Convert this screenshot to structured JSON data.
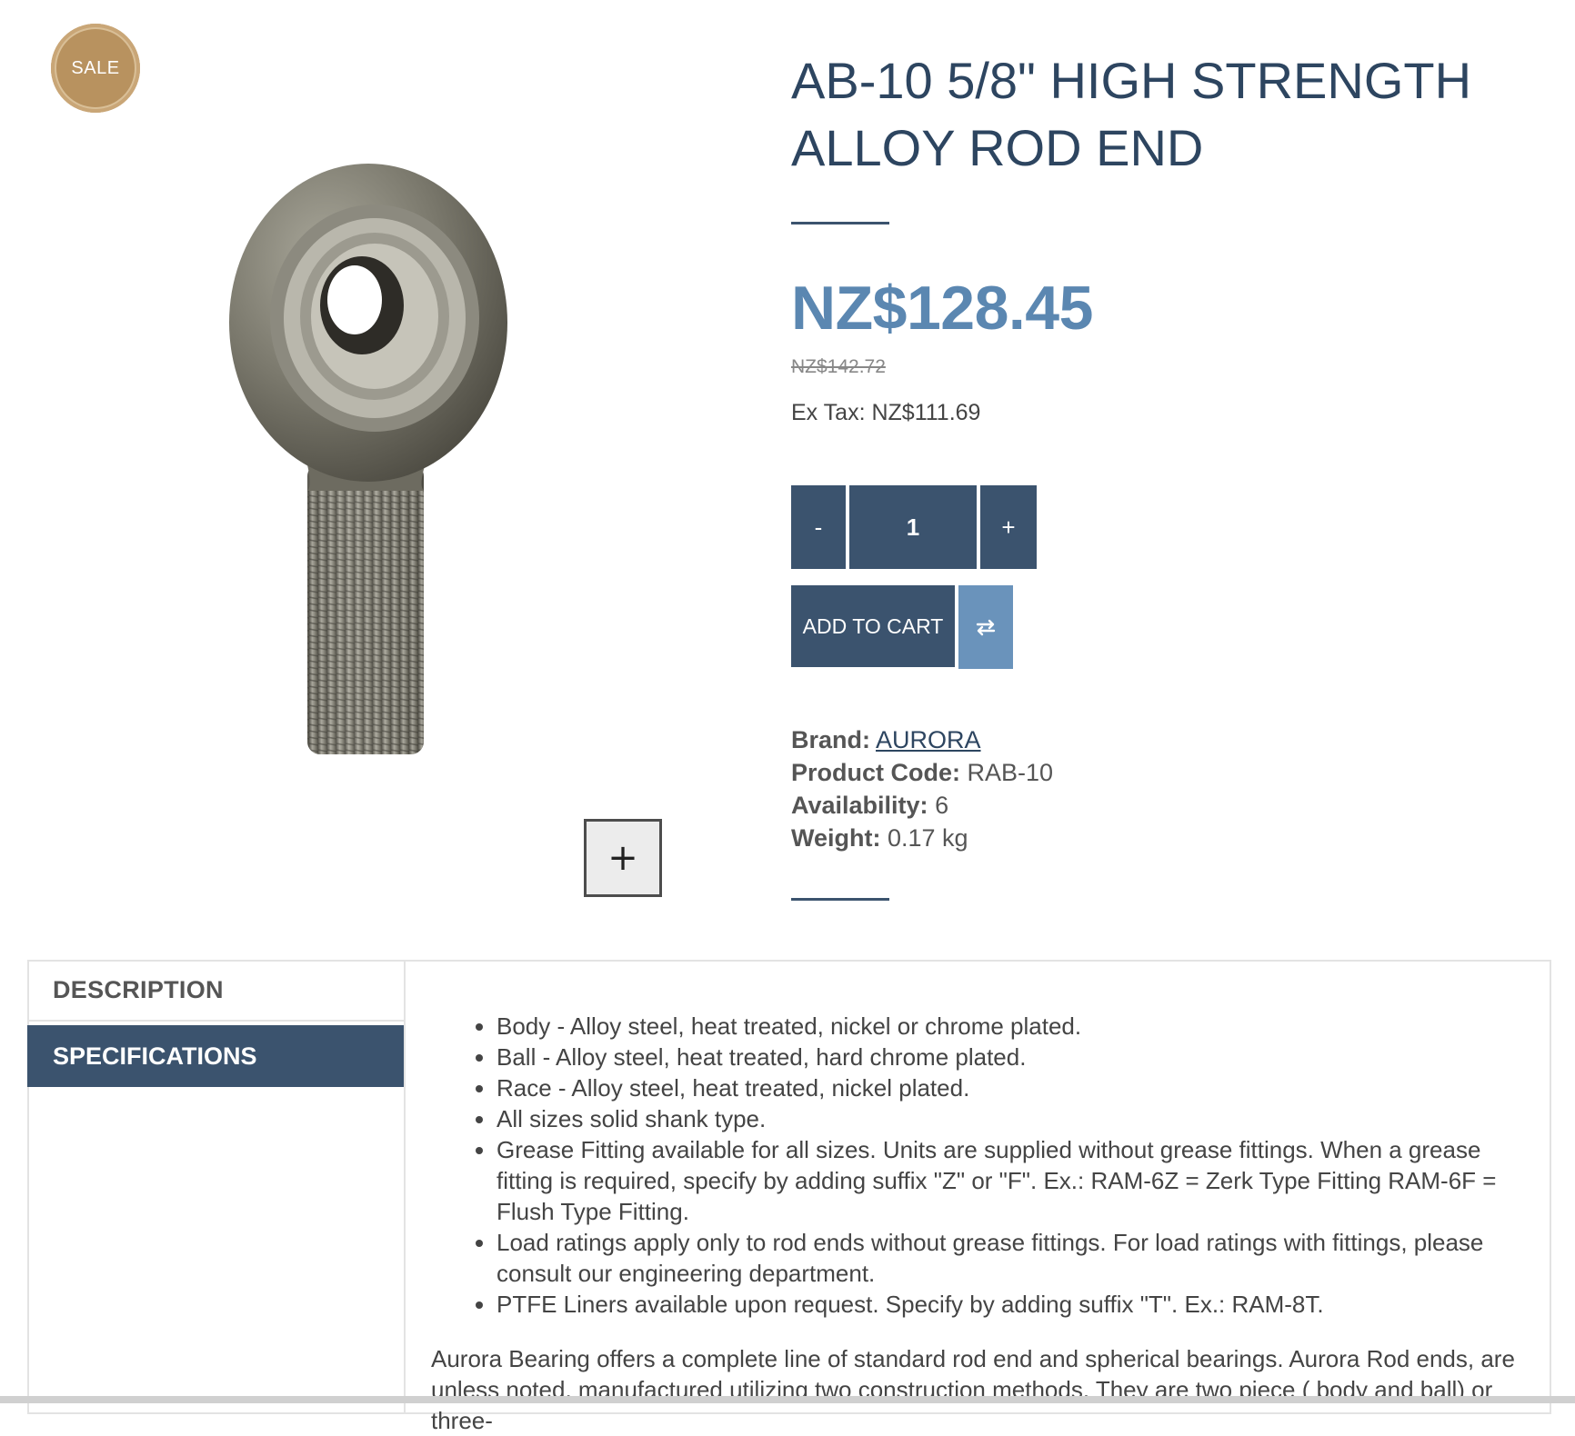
{
  "badge": {
    "label": "SALE",
    "color": "#b8925f"
  },
  "product": {
    "title": "AB-10 5/8\" HIGH STRENGTH ALLOY ROD END",
    "price": "NZ$128.45",
    "old_price": "NZ$142.72",
    "ex_tax": "Ex Tax: NZ$111.69"
  },
  "quantity": {
    "minus": "-",
    "value": "1",
    "plus": "+"
  },
  "cart": {
    "add_label": "ADD TO CART",
    "compare_icon": "compare-arrows-icon"
  },
  "meta": {
    "brand_label": "Brand:",
    "brand_value": "AURORA",
    "code_label": "Product Code:",
    "code_value": "RAB-10",
    "availability_label": "Availability:",
    "availability_value": "6",
    "weight_label": "Weight:",
    "weight_value": "0.17 kg"
  },
  "zoom": {
    "icon": "plus-icon",
    "label": "+"
  },
  "tabs": [
    {
      "label": "DESCRIPTION",
      "active": false
    },
    {
      "label": "SPECIFICATIONS",
      "active": true
    }
  ],
  "specifications": {
    "items": [
      "Body - Alloy steel, heat treated, nickel or chrome plated.",
      "Ball - Alloy steel, heat treated, hard chrome plated.",
      "Race - Alloy steel, heat treated, nickel plated.",
      "All sizes solid shank type.",
      "Grease Fitting available for all sizes. Units are supplied without grease fittings. When a grease fitting is required, specify by adding suffix \"Z\" or \"F\". Ex.: RAM-6Z = Zerk Type Fitting RAM-6F = Flush Type Fitting.",
      "Load ratings apply only to rod ends without grease fittings. For load ratings with fittings, please consult our engineering department.",
      "PTFE Liners available upon request. Specify by adding suffix \"T\". Ex.: RAM-8T."
    ],
    "paragraph": "Aurora Bearing offers a complete line of standard rod end and spherical bearings. Aurora Rod ends, are unless noted, manufactured utilizing two construction methods. They are two piece ( body and ball) or three-"
  },
  "colors": {
    "primary": "#3b536e",
    "price": "#5b87b1",
    "compare": "#6a93bb",
    "title": "#2d4560"
  }
}
